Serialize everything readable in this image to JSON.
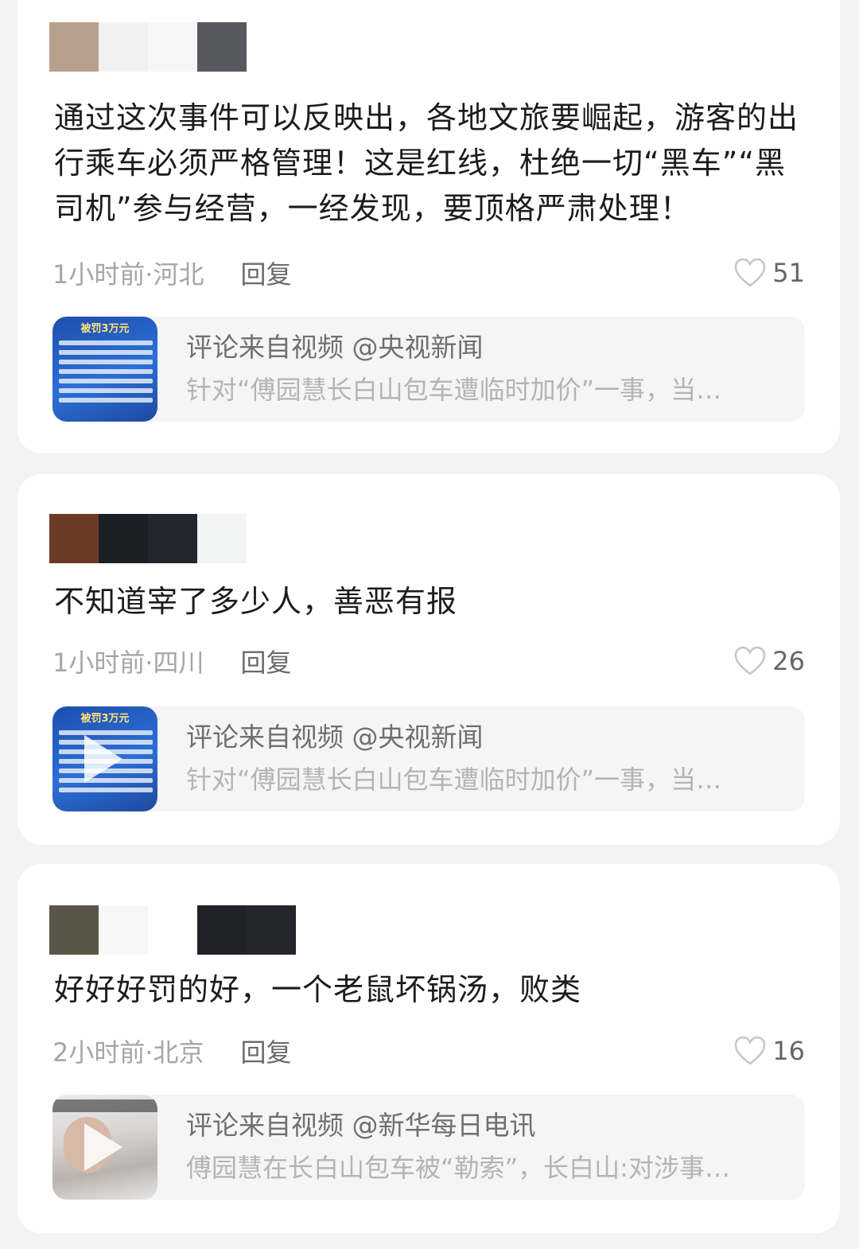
{
  "comments": [
    {
      "mosaic": [
        "#b8a08e",
        "#f1f1f1",
        "#f6f6f6",
        "#56595e"
      ],
      "text": "通过这次事件可以反映出，各地文旅要崛起，游客的出行乘车必须严格管理！这是红线，杜绝一切“黑车”“黑司机”参与经营，一经发现，要顶格严肃处理！",
      "time_location": "1小时前·河北",
      "reply": "回复",
      "likes": "51",
      "source": {
        "title": "评论来自视频 @央视新闻",
        "desc": "针对“傅园慧长白山包车遭临时加价”一事，当…",
        "thumb_banner": "被罚3万元"
      }
    },
    {
      "mosaic": [
        "#6b3a22",
        "#1d1f26",
        "#23262e",
        "#f3f4f4"
      ],
      "text": "不知道宰了多少人，善恶有报",
      "time_location": "1小时前·四川",
      "reply": "回复",
      "likes": "26",
      "source": {
        "title": "评论来自视频 @央视新闻",
        "desc": "针对“傅园慧长白山包车遭临时加价”一事，当…",
        "thumb_banner": "被罚3万元"
      }
    },
    {
      "mosaic": [
        "#5b5548",
        "#f7f7f7",
        "#ffffff",
        "#1f2028",
        "#24262e"
      ],
      "text": "好好好罚的好，一个老鼠坏锅汤，败类",
      "time_location": "2小时前·北京",
      "reply": "回复",
      "likes": "16",
      "source": {
        "title": "评论来自视频 @新华每日电讯",
        "desc": "傅园慧在长白山包车被“勒索”，长白山:对涉事…"
      }
    }
  ],
  "colors": {
    "page_bg": "#f3f3f3",
    "card_bg": "#ffffff",
    "source_bg": "#f5f5f5",
    "meta_gray": "#a6a6a6",
    "thumb_blue": "#2c6fd6"
  },
  "icons": {
    "like": "heart-outline-icon",
    "play": "play-icon"
  }
}
